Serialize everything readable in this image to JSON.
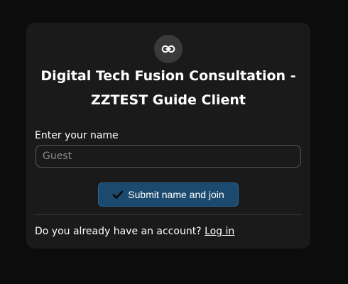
{
  "header": {
    "icon": "link-icon",
    "title": "Digital Tech Fusion Consultation - ZZTEST Guide Client"
  },
  "form": {
    "name_label": "Enter your name",
    "name_value": "",
    "name_placeholder": "Guest",
    "submit_icon": "checkmark-icon",
    "submit_label": "Submit name and join"
  },
  "footer": {
    "prompt": "Do you already have an account?",
    "login_link": "Log in"
  },
  "colors": {
    "page_background": "#0c0c0c",
    "card_background": "#1a1a1a",
    "icon_circle": "#3a3a3a",
    "button_background": "#1c4a6e",
    "button_border": "#2a6593"
  }
}
